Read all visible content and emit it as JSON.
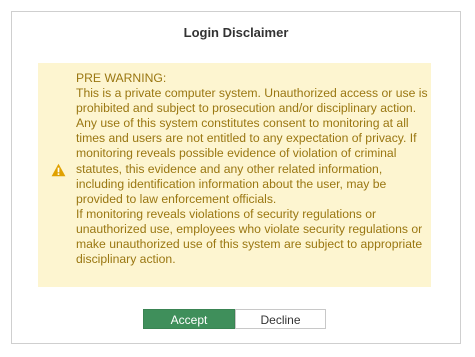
{
  "dialog": {
    "title": "Login Disclaimer"
  },
  "warning": {
    "icon": "warning-triangle-icon",
    "heading": "PRE WARNING:",
    "paragraph1": "This is a private computer system. Unauthorized access or use is prohibited and subject to prosecution and/or disciplinary action. Any use of this system constitutes consent to monitoring at all times and users are not entitled to any expectation of privacy. If monitoring reveals possible evidence of violation of criminal statutes, this evidence and any other related information, including identification information about the user, may be provided to law enforcement officials.",
    "paragraph2": "If monitoring reveals violations of security regulations or unauthorized use, employees who violate security regulations or make unauthorized use of this system are subject to appropriate disciplinary action.",
    "colors": {
      "background": "#fdf5d0",
      "text": "#9a7712",
      "icon": "#e0a100"
    }
  },
  "buttons": {
    "accept_label": "Accept",
    "decline_label": "Decline",
    "accept_color": "#3f8f5b"
  }
}
